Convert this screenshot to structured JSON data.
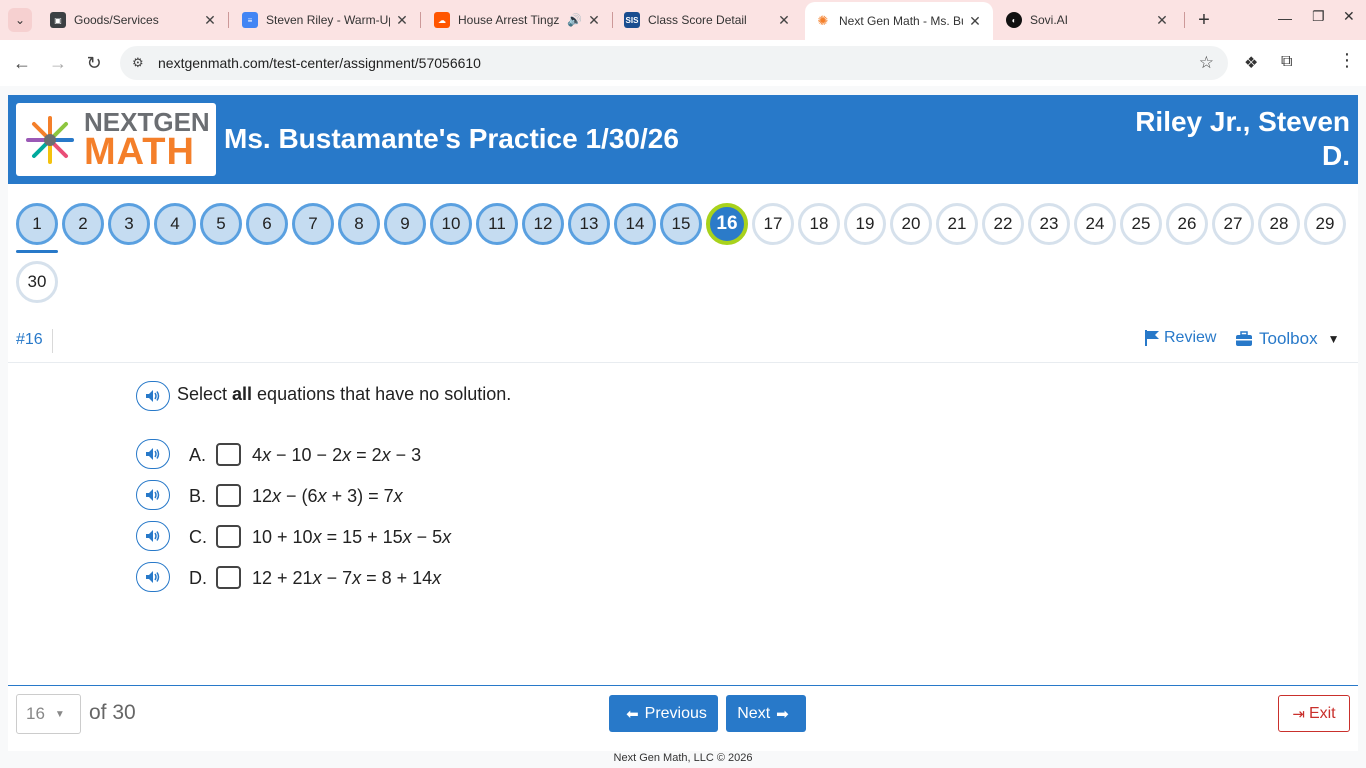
{
  "browser": {
    "tabs": [
      {
        "title": "Goods/Services",
        "favicon": "person-card-icon",
        "color": "#3c4043"
      },
      {
        "title": "Steven Riley - Warm-Up",
        "favicon": "docs-icon",
        "color": "#4285f4"
      },
      {
        "title": "House Arrest Tingz",
        "favicon": "soundcloud-icon",
        "color": "#ff5500"
      },
      {
        "title": "Class Score Detail",
        "favicon": "sis-icon",
        "color": "#1a4d8f"
      },
      {
        "title": "Next Gen Math - Ms. Bustamante",
        "favicon": "nextgen-icon",
        "color": "#f47f2a"
      },
      {
        "title": "Sovi.AI",
        "favicon": "sovi-icon",
        "color": "#111111"
      }
    ],
    "url": "nextgenmath.com/test-center/assignment/57056610"
  },
  "header": {
    "logo_next": "NEXTGEN",
    "logo_math": "MATH",
    "assignment_title": "Ms. Bustamante's Practice 1/30/26",
    "student_name_line1": "Riley Jr., Steven",
    "student_name_line2": "D."
  },
  "question_nav": {
    "current": 16,
    "total": 30,
    "answered_through": 15
  },
  "toolbar": {
    "question_number": "#16",
    "review_label": "Review",
    "toolbox_label": "Toolbox"
  },
  "question": {
    "prompt_before": "Select ",
    "prompt_bold": "all",
    "prompt_after": " equations that have no solution.",
    "choices": [
      {
        "letter": "A.",
        "text": "4x − 10 − 2x = 2x − 3"
      },
      {
        "letter": "B.",
        "text": "12x − (6x + 3) = 7x"
      },
      {
        "letter": "C.",
        "text": "10 + 10x = 15 + 15x − 5x"
      },
      {
        "letter": "D.",
        "text": "12 + 21x − 7x = 8 + 14x"
      }
    ]
  },
  "footer": {
    "page_value": "16",
    "of_total": "of 30",
    "previous_label": "Previous",
    "next_label": "Next",
    "exit_label": "Exit",
    "copyright": "Next Gen Math, LLC © 2026"
  },
  "colors": {
    "brand_blue": "#2879c9",
    "current_ring": "#a8d21c",
    "exit_red": "#c9302c"
  }
}
